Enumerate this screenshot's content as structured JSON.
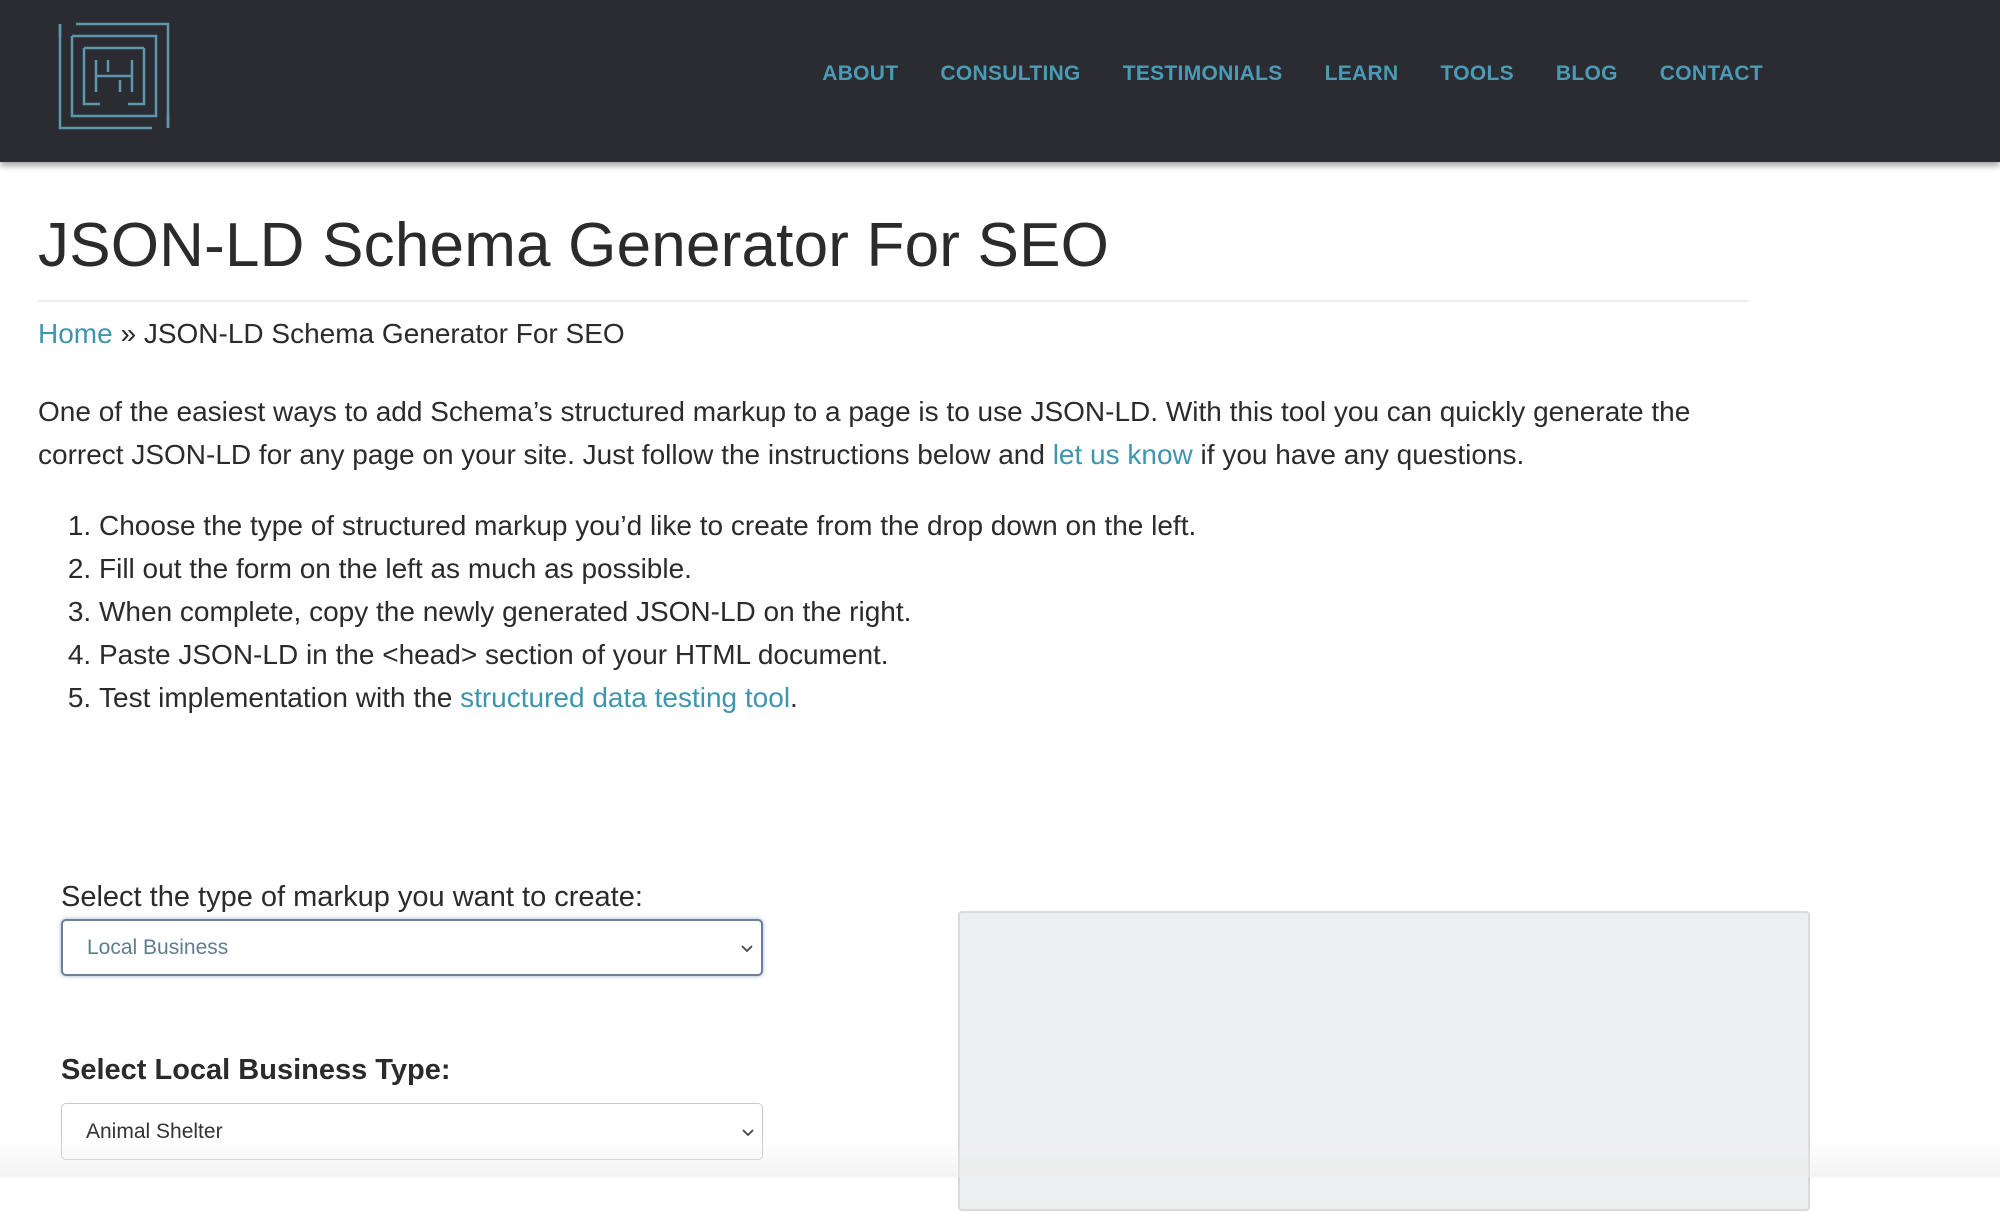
{
  "header": {
    "logo_icon": "maze-h-logo-icon",
    "nav": [
      {
        "label": "ABOUT"
      },
      {
        "label": "CONSULTING"
      },
      {
        "label": "TESTIMONIALS"
      },
      {
        "label": "LEARN"
      },
      {
        "label": "TOOLS"
      },
      {
        "label": "BLOG"
      },
      {
        "label": "CONTACT"
      }
    ]
  },
  "page": {
    "title": "JSON-LD Schema Generator For SEO",
    "breadcrumb": {
      "home": "Home",
      "separator": " » ",
      "current": "JSON-LD Schema Generator For SEO"
    },
    "intro": {
      "before_link": "One of the easiest ways to add Schema’s structured markup to a page is to use JSON-LD. With this tool you can quickly generate the correct JSON-LD for any page on your site. Just follow the instructions below and ",
      "link": "let us know",
      "after_link": " if you have any questions."
    },
    "steps": [
      {
        "text": "Choose the type of structured markup you’d like to create from the drop down on the left."
      },
      {
        "text": "Fill out the form on the left as much as possible."
      },
      {
        "text": "When complete, copy the newly generated JSON-LD on the right."
      },
      {
        "text": "Paste JSON-LD in the <head> section of your HTML document."
      },
      {
        "text": "Test implementation with the ",
        "link": "structured data testing tool",
        "after": "."
      }
    ]
  },
  "form": {
    "markup_label": "Select the type of markup you want to create:",
    "markup_value": "Local Business",
    "business_label": "Select Local Business Type:",
    "business_value": "Animal Shelter"
  },
  "colors": {
    "header_bg": "#2a2c31",
    "nav_link": "#4a9cb6",
    "link": "#3d95ae",
    "output_bg": "#eceff0"
  }
}
